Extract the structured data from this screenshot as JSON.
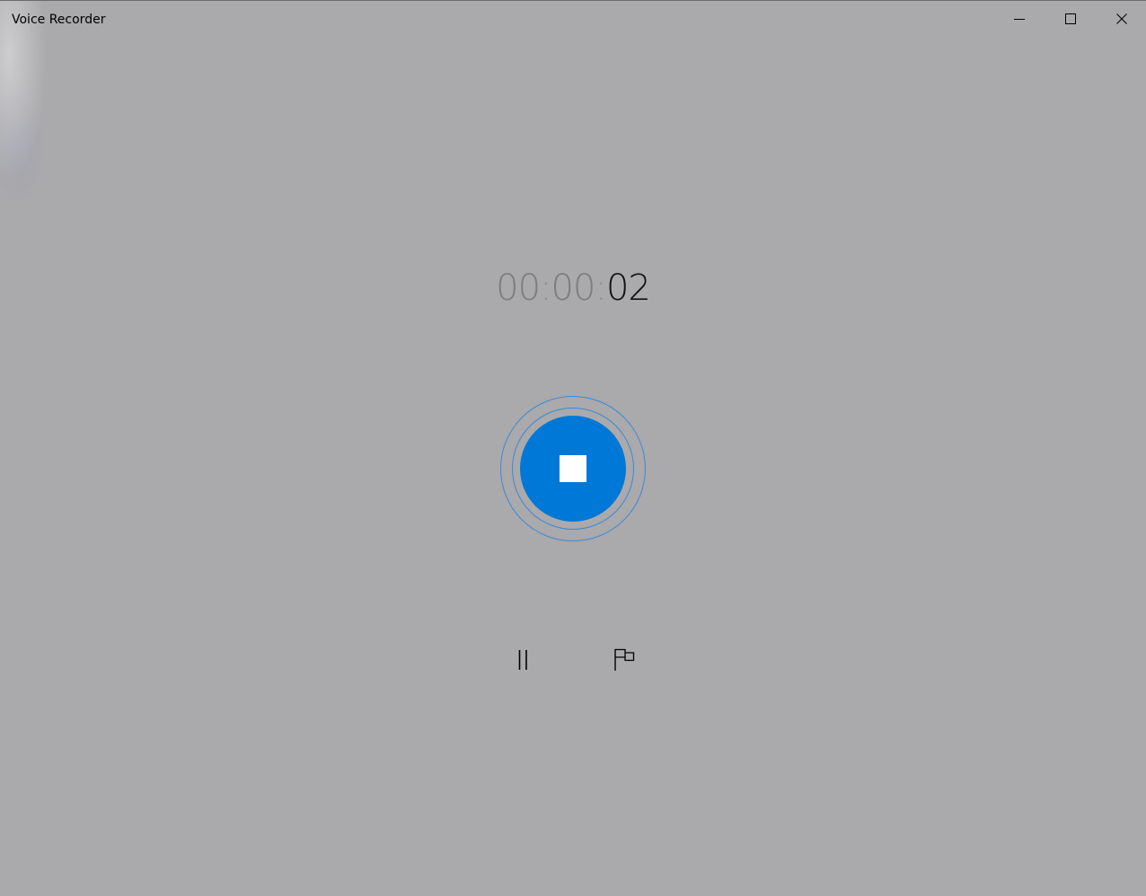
{
  "window": {
    "title": "Voice Recorder",
    "controls": {
      "minimize_icon": "minimize-icon",
      "maximize_icon": "maximize-icon",
      "close_icon": "close-icon"
    }
  },
  "recorder": {
    "timer": {
      "hours": "00",
      "sep1": ":",
      "minutes": "00",
      "sep2": ":",
      "seconds": "02"
    },
    "stop_icon": "stop-icon",
    "pause_icon": "pause-icon",
    "marker_icon": "flag-icon"
  },
  "colors": {
    "background": "#aaa9ab",
    "accent": "#0078d7",
    "ring": "#3a8ad8"
  }
}
